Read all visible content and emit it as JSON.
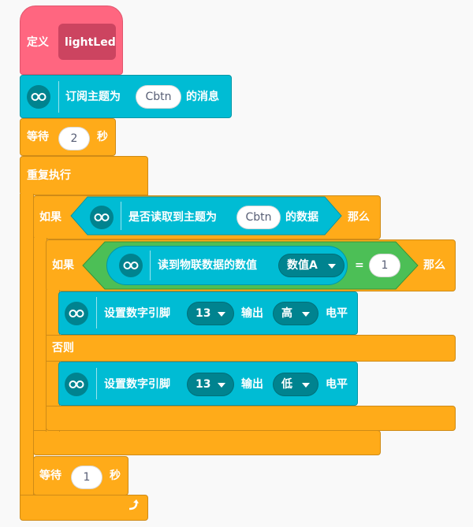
{
  "define_block": {
    "label": "定义",
    "name": "lightLed"
  },
  "subscribe_block": {
    "label": "订阅主题为",
    "topic": "Cbtn",
    "suffix": "的消息"
  },
  "wait1": {
    "label": "等待",
    "value": "2",
    "unit": "秒"
  },
  "forever": {
    "label": "重复执行"
  },
  "if1": {
    "label": "如果",
    "then": "那么"
  },
  "read_topic": {
    "label": "是否读取到主题为",
    "topic": "Cbtn",
    "suffix": "的数据"
  },
  "if2": {
    "label": "如果",
    "then": "那么",
    "else": "否则"
  },
  "read_value": {
    "label": "读到物联数据的数值",
    "dropdown": "数值A"
  },
  "compare": {
    "operator": "=",
    "value": "1"
  },
  "set_pin_high": {
    "label": "设置数字引脚",
    "pin": "13",
    "output": "输出",
    "level": "高",
    "suffix": "电平"
  },
  "set_pin_low": {
    "label": "设置数字引脚",
    "pin": "13",
    "output": "输出",
    "level": "低",
    "suffix": "电平"
  },
  "wait2": {
    "label": "等待",
    "value": "1",
    "unit": "秒"
  },
  "icons": [
    "extension-icon",
    "loop-arrow-icon",
    "dropdown-arrow-icon"
  ],
  "colors": {
    "control": "#ffab19",
    "extension": "#00bcd4",
    "define": "#ff6680",
    "operator": "#4cbf56"
  }
}
